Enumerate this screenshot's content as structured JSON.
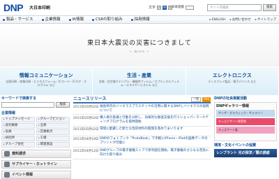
{
  "header": {
    "logo": "DNP",
    "company": "大日本印刷",
    "font_size_label": "文字",
    "font_sizes": [
      "小",
      "中",
      "大"
    ],
    "site_label": "日本語版",
    "search_placeholder": "サイト内検索",
    "search_button": "検索"
  },
  "nav": {
    "items": [
      "製品・サービス",
      "企業情報",
      "IR情報",
      "CSRの取り組み",
      "採用情報"
    ],
    "right": [
      "ENGLISH",
      "お問い合わせ",
      "サイトマップ"
    ]
  },
  "hero": {
    "title": "東日本大震災の災害につきまして",
    "more": "» more »"
  },
  "categories": [
    {
      "title": "情報コミュニケーション",
      "sub": "出版印刷・商業印刷・ビジネスフォーム／ICカード・ICタグ・ホログラム など"
    },
    {
      "title": "生活・産業",
      "sub": "包装・住空間マテリアル・機能性フィルム／オプティカルフィルム・エネルギーシステム など"
    },
    {
      "title": "エレクトロニクス",
      "sub": "ディスプレイ製品・電子デバイス など"
    }
  ],
  "left": {
    "keyword_title": "キーワードで検索する",
    "keyword_button": "検索",
    "company_title": "企業情報",
    "company_items": [
      "トップメッセージ",
      "グループビジョン",
      "会社概要",
      "沿革",
      "役員",
      "営業拠点",
      "研究所",
      "工場",
      "グループ会社",
      "関連施設"
    ],
    "buttons": [
      "資料請求",
      "サプライヤー・ホットライン",
      "イベント情報"
    ]
  },
  "news": {
    "title": "ニュースリリース",
    "list_button": "一覧",
    "rss": "RSS",
    "items": [
      {
        "date": "2011年05月02日",
        "text": "福島県内のバイオマスプラスチックの活用に関するDNPとバイオマスの提携について"
      },
      {
        "date": "2011年05月02日",
        "text": "購入者の意識と行動を分析し、効果的な販促支援を行うショッパーマーケティングプログラムを提供開始"
      },
      {
        "date": "2011年05月02日",
        "text": "環境に配慮した新たな包装材料の開発を進めてまいります"
      },
      {
        "date": "2011年04月19日",
        "text": "DNPのフォトブック「ProtoBook」で手軽にiPhone・iPadの画像データのプリントが可能に"
      },
      {
        "date": "2011年04月12日",
        "text": "DNPグループの電子書籍ストアで新刊配信開始、電子書籍のさらなる普及に向けた取り組み"
      }
    ]
  },
  "right": {
    "pr_title": "DNPの社会貢献活動",
    "gallery_title": "DNPギャラリー情報",
    "gallery_items": [
      "ギンザ・グラフィック・ギャラリー",
      "キッズデザイン賞受賞",
      "キッズアート展"
    ],
    "sec2_title": "環境・文化イベントの協賛",
    "banner": "レンブラント 光の探求／闇の誘惑"
  }
}
